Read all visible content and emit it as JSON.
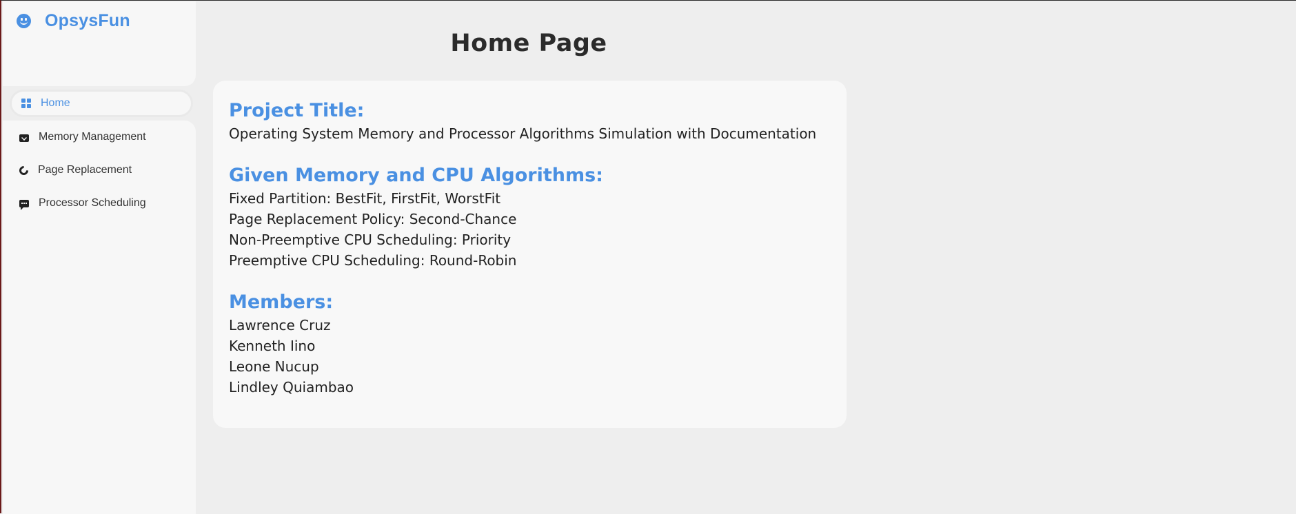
{
  "app": {
    "name": "OpsysFun",
    "brand_icon": "smiley-icon"
  },
  "sidebar": {
    "items": [
      {
        "label": "Home",
        "icon": "dashboard-grid-icon",
        "active": true
      },
      {
        "label": "Memory Management",
        "icon": "mail-icon",
        "active": false
      },
      {
        "label": "Page Replacement",
        "icon": "refresh-icon",
        "active": false
      },
      {
        "label": "Processor Scheduling",
        "icon": "chat-icon",
        "active": false
      }
    ]
  },
  "main": {
    "title": "Home Page",
    "sections": [
      {
        "heading": "Project Title:",
        "lines": [
          "Operating System Memory and Processor Algorithms Simulation with Documentation"
        ]
      },
      {
        "heading": "Given Memory and CPU Algorithms:",
        "lines": [
          "Fixed Partition: BestFit, FirstFit, WorstFit",
          "Page Replacement Policy: Second-Chance",
          "Non-Preemptive CPU Scheduling: Priority",
          "Preemptive CPU Scheduling: Round-Robin"
        ]
      },
      {
        "heading": "Members:",
        "lines": [
          "Lawrence Cruz",
          "Kenneth Iino",
          "Leone Nucup",
          "Lindley Quiambao"
        ]
      }
    ]
  },
  "colors": {
    "accent": "#4a90e2",
    "background": "#eeeeee",
    "panel": "#f7f7f7",
    "text": "#222222"
  }
}
